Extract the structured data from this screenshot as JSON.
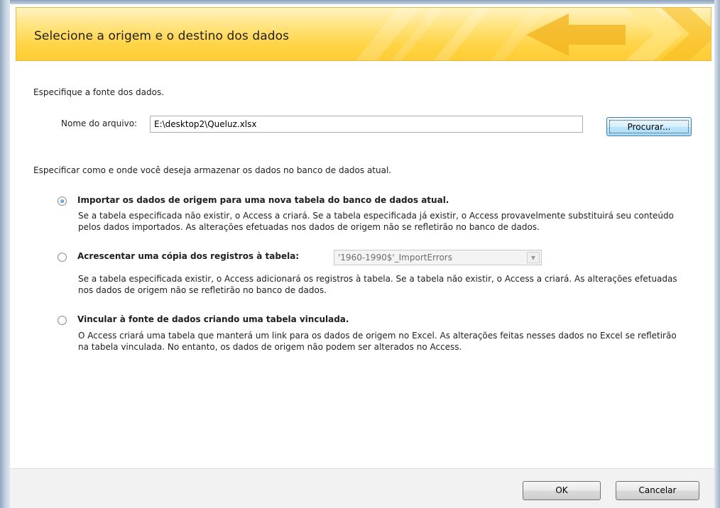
{
  "header": {
    "title": "Selecione a origem e o destino dos dados"
  },
  "source": {
    "prompt": "Especifique a fonte dos dados.",
    "file_label": "Nome do arquivo:",
    "file_value": "E:\\desktop2\\Queluz.xlsx",
    "browse_label": "Procurar..."
  },
  "storage": {
    "prompt": "Especificar como e onde você deseja armazenar os dados no banco de dados atual.",
    "options": [
      {
        "title": "Importar os dados de origem para uma nova tabela do banco de dados atual.",
        "description": "Se a tabela especificada não existir, o Access a criará. Se a tabela especificada já existir, o Access provavelmente substituirá seu conteúdo pelos dados importados. As alterações efetuadas nos dados de origem não se refletirão no banco de dados.",
        "checked": true
      },
      {
        "title": "Acrescentar uma cópia dos registros à tabela:",
        "description": "Se a tabela especificada existir, o Access adicionará os registros à tabela. Se a tabela não existir, o Access a criará. As alterações efetuadas nos dados de origem não se refletirão no banco de dados.",
        "checked": false,
        "table_select_value": "'1960-1990$'_ImportErrors"
      },
      {
        "title": "Vincular à fonte de dados criando uma tabela vinculada.",
        "description": "O Access criará uma tabela que manterá um link para os dados de origem no Excel. As alterações feitas nesses dados no Excel se refletirão na tabela vinculada. No entanto, os dados de origem não podem ser alterados no Access.",
        "checked": false
      }
    ]
  },
  "footer": {
    "ok_label": "OK",
    "cancel_label": "Cancelar"
  },
  "colors": {
    "banner": "#ffd447",
    "radio_selected": "#1a62b5",
    "focus_border": "#3c7fb1"
  }
}
